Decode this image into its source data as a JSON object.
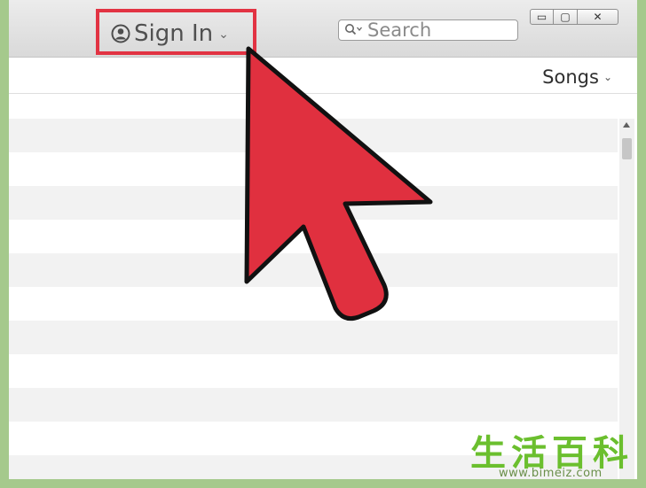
{
  "titlebar": {
    "signin_label": "Sign In",
    "search_placeholder": "Search",
    "window_buttons": {
      "minimize": "▭",
      "maximize": "▢",
      "close": "✕"
    }
  },
  "toolbar": {
    "view_label": "Songs"
  },
  "icons": {
    "account": "person-circle-icon",
    "search": "magnifier-icon",
    "chevron": "chevron-down-icon",
    "pointer": "red-arrow-pointer"
  },
  "colors": {
    "highlight": "#e23343",
    "arrow_fill": "#e0303f",
    "page_border": "#a5c98c",
    "row_stripe": "#f2f2f2"
  },
  "watermark": {
    "logo_text": "生活百科",
    "url": "www.bimeiz.com"
  }
}
